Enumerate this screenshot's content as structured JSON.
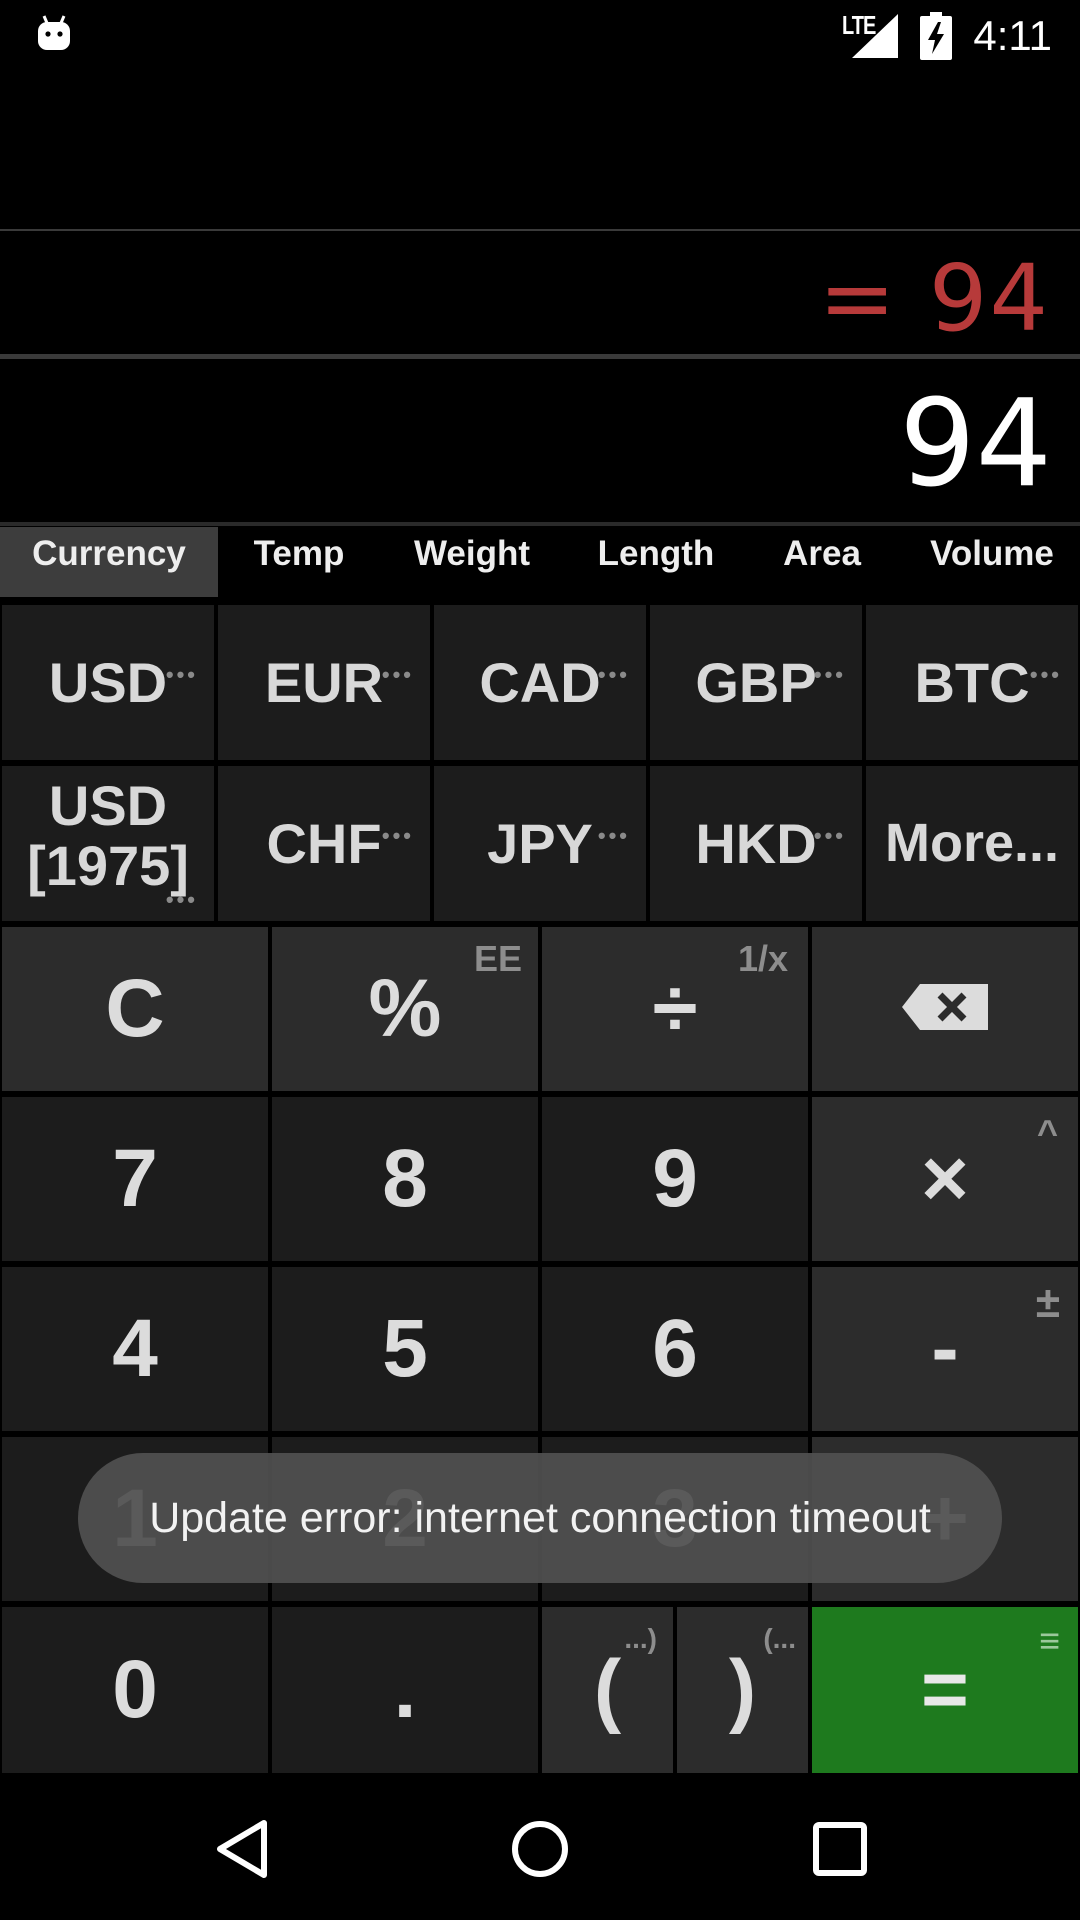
{
  "status_bar": {
    "network": "LTE",
    "time": "4:11"
  },
  "display": {
    "result": "= 94",
    "input": "94"
  },
  "tabs": [
    {
      "label": "Currency"
    },
    {
      "label": "Temp"
    },
    {
      "label": "Weight"
    },
    {
      "label": "Length"
    },
    {
      "label": "Area"
    },
    {
      "label": "Volume"
    }
  ],
  "currency_row1": [
    {
      "label": "USD",
      "more": "•••"
    },
    {
      "label": "EUR",
      "more": "•••"
    },
    {
      "label": "CAD",
      "more": "•••"
    },
    {
      "label": "GBP",
      "more": "•••"
    },
    {
      "label": "BTC",
      "more": "•••"
    }
  ],
  "currency_row2": [
    {
      "label_line1": "USD",
      "label_line2": "[1975]",
      "more": "•••"
    },
    {
      "label": "CHF",
      "more": "•••"
    },
    {
      "label": "JPY",
      "more": "•••"
    },
    {
      "label": "HKD",
      "more": "•••"
    },
    {
      "label": "More..."
    }
  ],
  "keys": {
    "clear": "C",
    "percent": "%",
    "percent_alt": "EE",
    "divide": "÷",
    "divide_alt": "1/x",
    "seven": "7",
    "eight": "8",
    "nine": "9",
    "multiply": "×",
    "multiply_alt": "^",
    "four": "4",
    "five": "5",
    "six": "6",
    "minus": "-",
    "minus_alt": "±",
    "one": "1",
    "two": "2",
    "three": "3",
    "plus": "+",
    "zero": "0",
    "dot": ".",
    "open_paren": "(",
    "open_paren_alt": "...)",
    "close_paren": ")",
    "close_paren_alt": "(...",
    "equals": "=",
    "equals_alt": "≡"
  },
  "toast": {
    "message": "Update error: internet connection timeout"
  },
  "colors": {
    "result": "#b73a3a",
    "equals_key": "#1e7a1e",
    "key_bg": "#1c1c1c",
    "op_bg": "#2c2c2c"
  }
}
